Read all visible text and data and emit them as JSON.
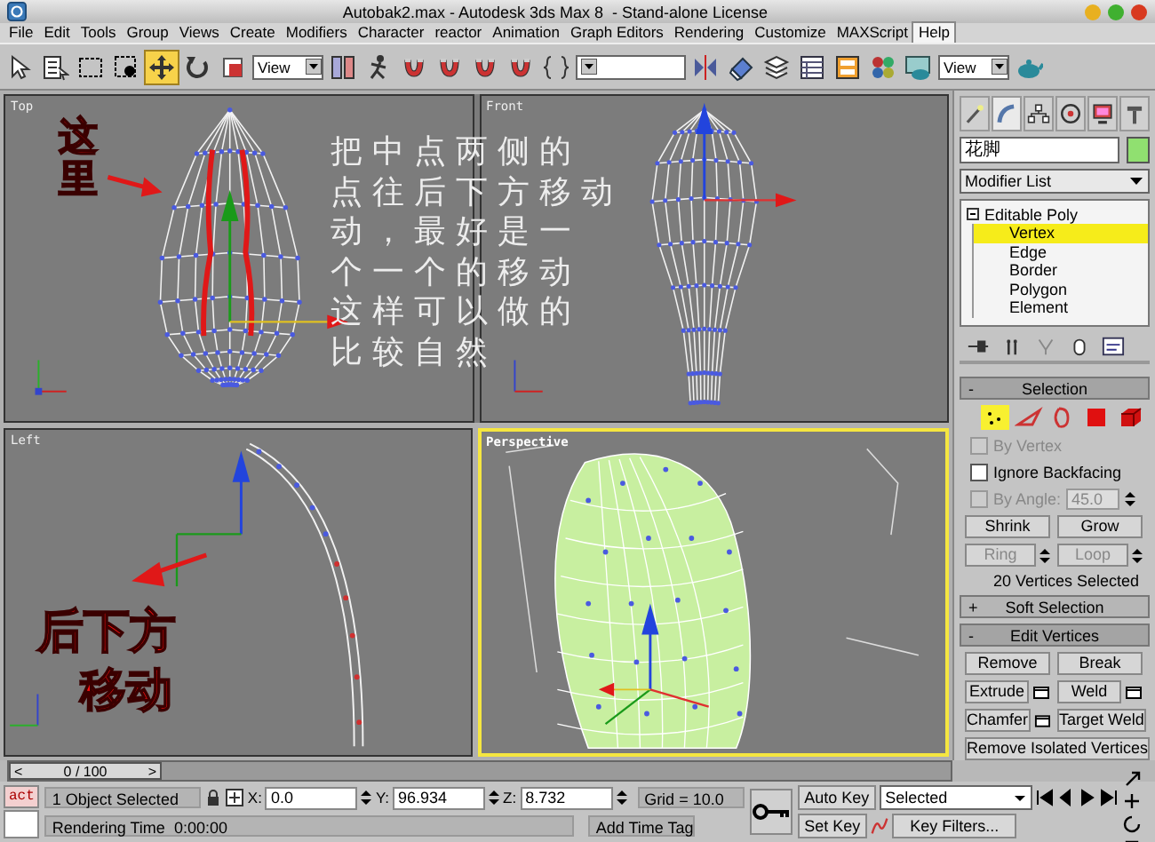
{
  "window": {
    "title": "Autobak2.max - Autodesk 3ds Max 8  - Stand-alone License"
  },
  "menu": [
    {
      "label": "File",
      "selected": false
    },
    {
      "label": "Edit",
      "selected": false
    },
    {
      "label": "Tools",
      "selected": false
    },
    {
      "label": "Group",
      "selected": false
    },
    {
      "label": "Views",
      "selected": false
    },
    {
      "label": "Create",
      "selected": false
    },
    {
      "label": "Modifiers",
      "selected": false
    },
    {
      "label": "Character",
      "selected": false
    },
    {
      "label": "reactor",
      "selected": false
    },
    {
      "label": "Animation",
      "selected": false
    },
    {
      "label": "Graph Editors",
      "selected": false
    },
    {
      "label": "Rendering",
      "selected": false
    },
    {
      "label": "Customize",
      "selected": false
    },
    {
      "label": "MAXScript",
      "selected": false
    },
    {
      "label": "Help",
      "selected": true
    }
  ],
  "tools": [
    {
      "kind": "select",
      "selected": false
    },
    {
      "kind": "select-by-name",
      "selected": false
    },
    {
      "kind": "region",
      "selected": false
    },
    {
      "kind": "window-crossing",
      "selected": false
    },
    {
      "kind": "move",
      "selected": true
    },
    {
      "kind": "rotate",
      "selected": false
    },
    {
      "kind": "scale",
      "selected": false
    },
    {
      "kind": "dropdown",
      "value": "View"
    },
    {
      "kind": "pivot",
      "selected": false
    },
    {
      "kind": "manipulate",
      "selected": false
    },
    {
      "kind": "snap",
      "selected": false
    },
    {
      "kind": "angle-snap",
      "selected": false
    },
    {
      "kind": "percent-snap",
      "selected": false
    },
    {
      "kind": "spinner-snap",
      "selected": false
    },
    {
      "kind": "named-selection",
      "selected": false
    },
    {
      "kind": "dropdown"
    },
    {
      "kind": "mirror",
      "selected": false
    },
    {
      "kind": "align",
      "selected": false
    },
    {
      "kind": "layers",
      "selected": false
    },
    {
      "kind": "curve-editor",
      "selected": false
    },
    {
      "kind": "schematic",
      "selected": false
    },
    {
      "kind": "material-editor",
      "selected": false
    },
    {
      "kind": "render-scene",
      "selected": false
    },
    {
      "kind": "dropdown",
      "value": "View"
    },
    {
      "kind": "quick-render",
      "selected": false
    }
  ],
  "viewports": [
    {
      "label": "Top",
      "kind": "top",
      "active": false
    },
    {
      "label": "Front",
      "kind": "front",
      "active": false
    },
    {
      "label": "Left",
      "kind": "left",
      "active": false
    },
    {
      "label": "Perspective",
      "kind": "perspective",
      "active": true
    }
  ],
  "handwriting": {
    "top_note": "这里",
    "left_note": [
      "后下方",
      "移动"
    ]
  },
  "overlay_note": [
    "把中点两侧的",
    "点往后下方移动",
    "动，最好是一",
    "个一个的移动",
    "这样可以做的",
    "比较自然"
  ],
  "command_panel": {
    "object_name": "花脚",
    "modifier_list": "Modifier List",
    "stack": [
      {
        "label": "Editable Poly",
        "expanded": true,
        "selected": false,
        "children": [
          {
            "label": "Vertex",
            "selected": true
          },
          {
            "label": "Edge",
            "selected": false
          },
          {
            "label": "Border",
            "selected": false
          },
          {
            "label": "Polygon",
            "selected": false
          },
          {
            "label": "Element",
            "selected": false
          }
        ]
      }
    ],
    "rollouts": [
      {
        "kind": "selection",
        "sign": "-",
        "title": "Selection",
        "expanded": true
      },
      {
        "kind": "soft-selection",
        "sign": "+",
        "title": "Soft Selection",
        "expanded": false
      },
      {
        "kind": "edit-vertices",
        "sign": "-",
        "title": "Edit Vertices",
        "expanded": true
      }
    ],
    "subobject_buttons": [
      {
        "kind": "vertex",
        "selected": true
      },
      {
        "kind": "edge",
        "selected": false
      },
      {
        "kind": "border",
        "selected": false
      },
      {
        "kind": "polygon",
        "selected": false
      },
      {
        "kind": "element",
        "selected": false
      }
    ],
    "options": [
      {
        "label": "By Vertex",
        "checked": false,
        "disabled": true
      },
      {
        "label": "Ignore Backfacing",
        "checked": false,
        "disabled": false
      },
      {
        "label": "By Angle:",
        "checked": false,
        "disabled": true,
        "value": "45.0"
      }
    ],
    "selection_buttons": [
      {
        "label": "Shrink",
        "disabled": false,
        "spinner": false
      },
      {
        "label": "Grow",
        "disabled": false,
        "spinner": false
      },
      {
        "label": "Ring",
        "disabled": true,
        "spinner": true
      },
      {
        "label": "Loop",
        "disabled": true,
        "spinner": true
      }
    ],
    "selection_status": "20 Vertices Selected",
    "vertex_buttons": [
      {
        "label": "Remove",
        "settings": false,
        "wide": false
      },
      {
        "label": "Break",
        "settings": false,
        "wide": false
      },
      {
        "label": "Extrude",
        "settings": true,
        "wide": false
      },
      {
        "label": "Weld",
        "settings": true,
        "wide": false
      },
      {
        "label": "Chamfer",
        "settings": true,
        "wide": false
      },
      {
        "label": "Target Weld",
        "settings": false,
        "wide": false
      },
      {
        "label": "Remove Isolated Vertices",
        "settings": false,
        "wide": true
      }
    ]
  },
  "time_slider": {
    "label": "0 / 100",
    "level": 0,
    "prev": "<",
    "next": ">"
  },
  "status_bar": {
    "act": "act",
    "selection_info": "1 Object Selected",
    "prompt": "Rendering Time  0:00:00",
    "coords": [
      {
        "axis": "X:",
        "value": "0.0"
      },
      {
        "axis": "Y:",
        "value": "96.934"
      },
      {
        "axis": "Z:",
        "value": "8.732"
      }
    ],
    "grid": "Grid = 10.0",
    "add_time_tag": "Add Time Tag",
    "auto_key": "Auto Key",
    "key_mode": "Selected",
    "set_key": "Set Key",
    "key_filters": "Key Filters..."
  }
}
